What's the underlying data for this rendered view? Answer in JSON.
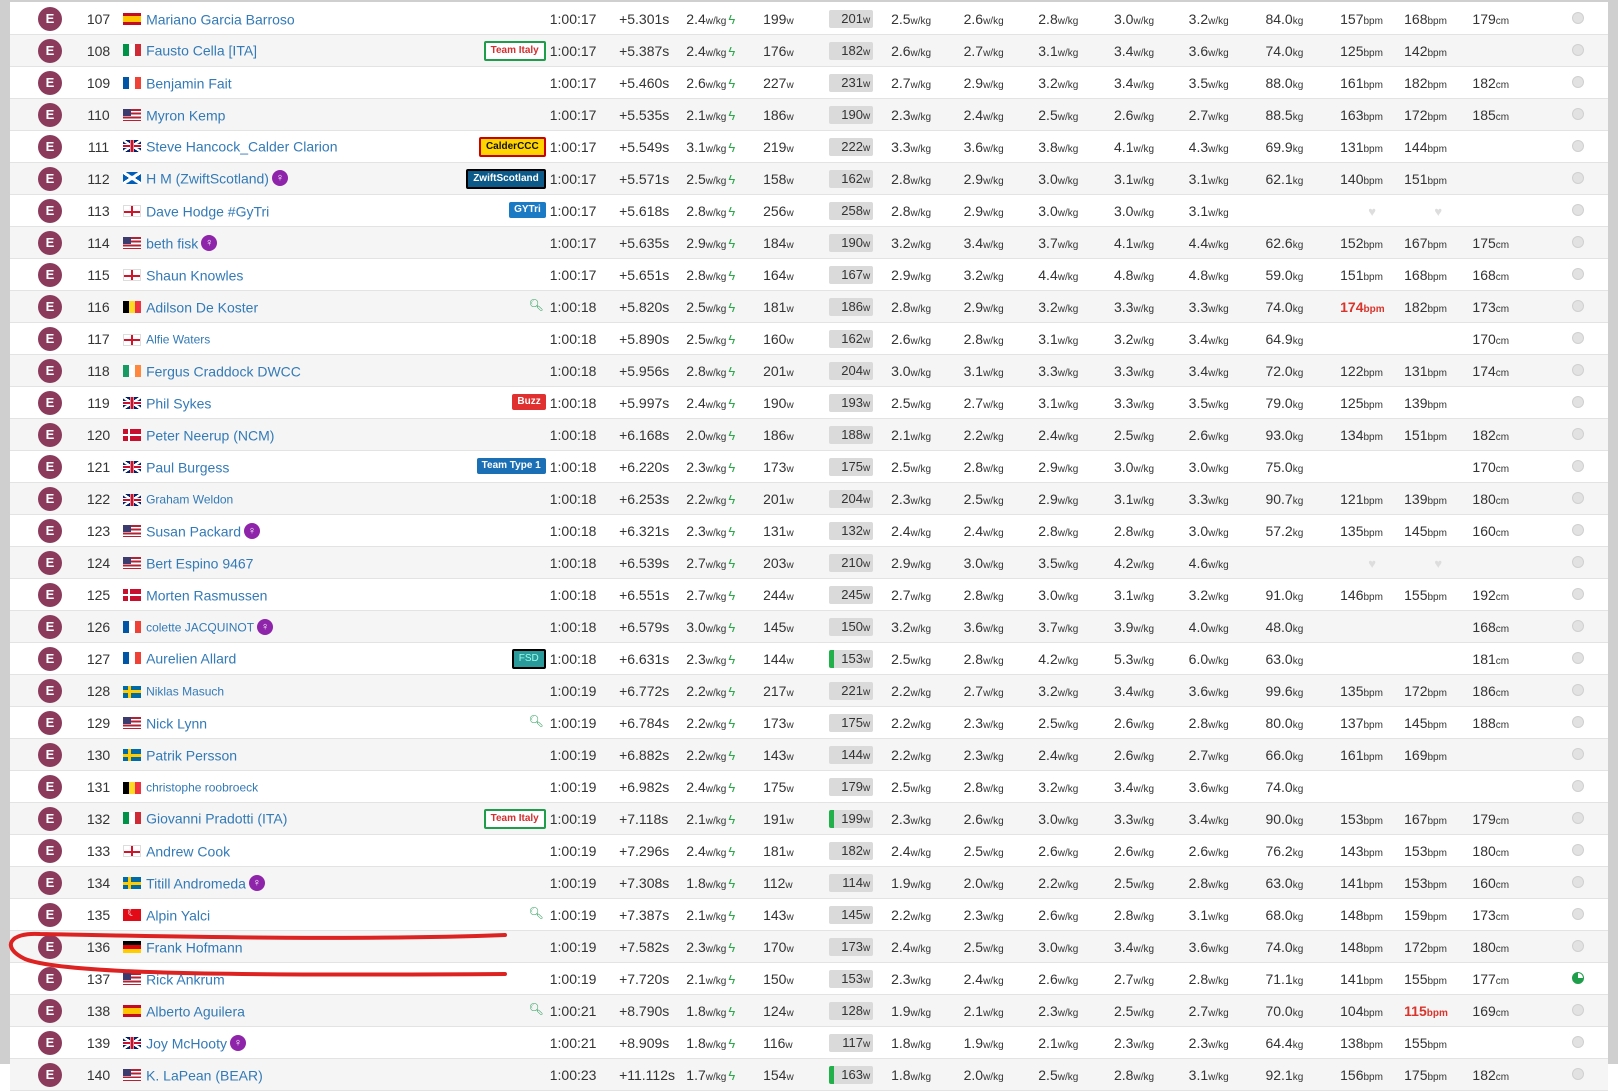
{
  "category_label": "E",
  "colors": {
    "category_badge": "#8b3a5c",
    "link": "#337ab7",
    "bolt": "#2aa84a",
    "annotation": "#dd2222"
  },
  "rows": [
    {
      "pos": "107",
      "flag": "es",
      "name": "Mariano Garcia Barroso",
      "female": false,
      "team": null,
      "search": false,
      "time": "1:00:17",
      "gap": "+5.301s",
      "wkg": "2.4",
      "avg": "199",
      "np": "201",
      "np_green": false,
      "p1": "2.5",
      "p2": "2.6",
      "p3": "2.8",
      "p4": "3.0",
      "p5": "3.2",
      "weight": "84.0",
      "hr1": "157",
      "hr2": "168",
      "height": "179",
      "pie_active": false
    },
    {
      "pos": "108",
      "flag": "it",
      "name": "Fausto Cella [ITA]",
      "female": false,
      "team": {
        "label": "Team Italy",
        "style": "team-italy"
      },
      "search": false,
      "time": "1:00:17",
      "gap": "+5.387s",
      "wkg": "2.4",
      "avg": "176",
      "np": "182",
      "np_green": false,
      "p1": "2.6",
      "p2": "2.7",
      "p3": "3.1",
      "p4": "3.4",
      "p5": "3.6",
      "weight": "74.0",
      "hr1": "125",
      "hr2": "142",
      "height": "",
      "pie_active": false
    },
    {
      "pos": "109",
      "flag": "fr",
      "name": "Benjamin Fait",
      "female": false,
      "team": null,
      "search": false,
      "time": "1:00:17",
      "gap": "+5.460s",
      "wkg": "2.6",
      "avg": "227",
      "np": "231",
      "np_green": false,
      "p1": "2.7",
      "p2": "2.9",
      "p3": "3.2",
      "p4": "3.4",
      "p5": "3.5",
      "weight": "88.0",
      "hr1": "161",
      "hr2": "182",
      "height": "182",
      "pie_active": false
    },
    {
      "pos": "110",
      "flag": "us",
      "name": "Myron Kemp",
      "female": false,
      "team": null,
      "search": false,
      "time": "1:00:17",
      "gap": "+5.535s",
      "wkg": "2.1",
      "avg": "186",
      "np": "190",
      "np_green": false,
      "p1": "2.3",
      "p2": "2.4",
      "p3": "2.5",
      "p4": "2.6",
      "p5": "2.7",
      "weight": "88.5",
      "hr1": "163",
      "hr2": "172",
      "height": "185",
      "pie_active": false
    },
    {
      "pos": "111",
      "flag": "gb",
      "name": "Steve Hancock_Calder Clarion",
      "female": false,
      "team": {
        "label": "CalderCCC",
        "style": "team-calder"
      },
      "search": false,
      "time": "1:00:17",
      "gap": "+5.549s",
      "wkg": "3.1",
      "avg": "219",
      "np": "222",
      "np_green": false,
      "p1": "3.3",
      "p2": "3.6",
      "p3": "3.8",
      "p4": "4.1",
      "p5": "4.3",
      "weight": "69.9",
      "hr1": "131",
      "hr2": "144",
      "height": "",
      "pie_active": false
    },
    {
      "pos": "112",
      "flag": "sc",
      "name": "H M (ZwiftScotland)",
      "female": true,
      "team": {
        "label": "ZwiftScotland",
        "style": "team-zs"
      },
      "search": false,
      "time": "1:00:17",
      "gap": "+5.571s",
      "wkg": "2.5",
      "avg": "158",
      "np": "162",
      "np_green": false,
      "p1": "2.8",
      "p2": "2.9",
      "p3": "3.0",
      "p4": "3.1",
      "p5": "3.1",
      "weight": "62.1",
      "hr1": "140",
      "hr2": "151",
      "height": "",
      "pie_active": false
    },
    {
      "pos": "113",
      "flag": "en",
      "name": "Dave Hodge #GyTri",
      "female": false,
      "team": {
        "label": "GYTri",
        "style": "team-gytri"
      },
      "search": false,
      "time": "1:00:17",
      "gap": "+5.618s",
      "wkg": "2.8",
      "avg": "256",
      "np": "258",
      "np_green": false,
      "p1": "2.8",
      "p2": "2.9",
      "p3": "3.0",
      "p4": "3.0",
      "p5": "3.1",
      "weight": "",
      "hr1": "",
      "hr2": "",
      "height": "",
      "no_hr": true,
      "pie_active": false
    },
    {
      "pos": "114",
      "flag": "us",
      "name": "beth fisk",
      "female": true,
      "team": null,
      "search": false,
      "time": "1:00:17",
      "gap": "+5.635s",
      "wkg": "2.9",
      "avg": "184",
      "np": "190",
      "np_green": false,
      "p1": "3.2",
      "p2": "3.4",
      "p3": "3.7",
      "p4": "4.1",
      "p5": "4.4",
      "weight": "62.6",
      "hr1": "152",
      "hr2": "167",
      "height": "175",
      "pie_active": false
    },
    {
      "pos": "115",
      "flag": "en",
      "name": "Shaun Knowles",
      "female": false,
      "team": null,
      "search": false,
      "time": "1:00:17",
      "gap": "+5.651s",
      "wkg": "2.8",
      "avg": "164",
      "np": "167",
      "np_green": false,
      "p1": "2.9",
      "p2": "3.2",
      "p3": "4.4",
      "p4": "4.8",
      "p5": "4.8",
      "weight": "59.0",
      "hr1": "151",
      "hr2": "168",
      "height": "168",
      "pie_active": false
    },
    {
      "pos": "116",
      "flag": "be",
      "name": "Adilson De Koster",
      "female": false,
      "team": null,
      "search": true,
      "time": "1:00:18",
      "gap": "+5.820s",
      "wkg": "2.5",
      "avg": "181",
      "np": "186",
      "np_green": false,
      "p1": "2.8",
      "p2": "2.9",
      "p3": "3.2",
      "p4": "3.3",
      "p5": "3.3",
      "weight": "74.0",
      "hr1": "174",
      "hr1_red": true,
      "hr2": "182",
      "height": "173",
      "pie_active": false
    },
    {
      "pos": "117",
      "flag": "en",
      "name": "Alfie Waters",
      "small": true,
      "female": false,
      "team": null,
      "search": false,
      "time": "1:00:18",
      "gap": "+5.890s",
      "wkg": "2.5",
      "avg": "160",
      "np": "162",
      "np_green": false,
      "p1": "2.6",
      "p2": "2.8",
      "p3": "3.1",
      "p4": "3.2",
      "p5": "3.4",
      "weight": "64.9",
      "hr1": "",
      "hr2": "",
      "height": "170",
      "pie_active": false
    },
    {
      "pos": "118",
      "flag": "ie",
      "name": "Fergus Craddock DWCC",
      "female": false,
      "team": null,
      "search": false,
      "time": "1:00:18",
      "gap": "+5.956s",
      "wkg": "2.8",
      "avg": "201",
      "np": "204",
      "np_green": false,
      "p1": "3.0",
      "p2": "3.1",
      "p3": "3.3",
      "p4": "3.3",
      "p5": "3.4",
      "weight": "72.0",
      "hr1": "122",
      "hr2": "131",
      "height": "174",
      "pie_active": false
    },
    {
      "pos": "119",
      "flag": "gb",
      "name": "Phil Sykes",
      "female": false,
      "team": {
        "label": "Buzz",
        "style": "team-buzz"
      },
      "search": false,
      "time": "1:00:18",
      "gap": "+5.997s",
      "wkg": "2.4",
      "avg": "190",
      "np": "193",
      "np_green": false,
      "p1": "2.5",
      "p2": "2.7",
      "p3": "3.1",
      "p4": "3.3",
      "p5": "3.5",
      "weight": "79.0",
      "hr1": "125",
      "hr2": "139",
      "height": "",
      "pie_active": false
    },
    {
      "pos": "120",
      "flag": "dk",
      "name": "Peter Neerup (NCM)",
      "female": false,
      "team": null,
      "search": false,
      "time": "1:00:18",
      "gap": "+6.168s",
      "wkg": "2.0",
      "avg": "186",
      "np": "188",
      "np_green": false,
      "p1": "2.1",
      "p2": "2.2",
      "p3": "2.4",
      "p4": "2.5",
      "p5": "2.6",
      "weight": "93.0",
      "hr1": "134",
      "hr2": "151",
      "height": "182",
      "pie_active": false
    },
    {
      "pos": "121",
      "flag": "gb",
      "name": "Paul Burgess",
      "female": false,
      "team": {
        "label": "Team Type 1",
        "style": "team-t1"
      },
      "search": false,
      "time": "1:00:18",
      "gap": "+6.220s",
      "wkg": "2.3",
      "avg": "173",
      "np": "175",
      "np_green": false,
      "p1": "2.5",
      "p2": "2.8",
      "p3": "2.9",
      "p4": "3.0",
      "p5": "3.0",
      "weight": "75.0",
      "hr1": "",
      "hr2": "",
      "height": "170",
      "pie_active": false
    },
    {
      "pos": "122",
      "flag": "gb",
      "name": "Graham Weldon",
      "small": true,
      "female": false,
      "team": null,
      "search": false,
      "time": "1:00:18",
      "gap": "+6.253s",
      "wkg": "2.2",
      "avg": "201",
      "np": "204",
      "np_green": false,
      "p1": "2.3",
      "p2": "2.5",
      "p3": "2.9",
      "p4": "3.1",
      "p5": "3.3",
      "weight": "90.7",
      "hr1": "121",
      "hr2": "139",
      "height": "180",
      "pie_active": false
    },
    {
      "pos": "123",
      "flag": "us",
      "name": "Susan Packard",
      "female": true,
      "team": null,
      "search": false,
      "time": "1:00:18",
      "gap": "+6.321s",
      "wkg": "2.3",
      "avg": "131",
      "np": "132",
      "np_green": false,
      "p1": "2.4",
      "p2": "2.4",
      "p3": "2.8",
      "p4": "2.8",
      "p5": "3.0",
      "weight": "57.2",
      "hr1": "135",
      "hr2": "145",
      "height": "160",
      "pie_active": false
    },
    {
      "pos": "124",
      "flag": "us",
      "name": "Bert Espino 9467",
      "female": false,
      "team": null,
      "search": false,
      "time": "1:00:18",
      "gap": "+6.539s",
      "wkg": "2.7",
      "avg": "203",
      "np": "210",
      "np_green": false,
      "p1": "2.9",
      "p2": "3.0",
      "p3": "3.5",
      "p4": "4.2",
      "p5": "4.6",
      "weight": "",
      "hr1": "",
      "hr2": "",
      "height": "",
      "no_hr": true,
      "pie_active": false
    },
    {
      "pos": "125",
      "flag": "dk",
      "name": "Morten Rasmussen",
      "female": false,
      "team": null,
      "search": false,
      "time": "1:00:18",
      "gap": "+6.551s",
      "wkg": "2.7",
      "avg": "244",
      "np": "245",
      "np_green": false,
      "p1": "2.7",
      "p2": "2.8",
      "p3": "3.0",
      "p4": "3.1",
      "p5": "3.2",
      "weight": "91.0",
      "hr1": "146",
      "hr2": "155",
      "height": "192",
      "pie_active": false
    },
    {
      "pos": "126",
      "flag": "fr",
      "name": "colette JACQUINOT",
      "small": true,
      "female": true,
      "team": null,
      "search": false,
      "time": "1:00:18",
      "gap": "+6.579s",
      "wkg": "3.0",
      "avg": "145",
      "np": "150",
      "np_green": false,
      "p1": "3.2",
      "p2": "3.6",
      "p3": "3.7",
      "p4": "3.9",
      "p5": "4.0",
      "weight": "48.0",
      "hr1": "",
      "hr2": "",
      "height": "168",
      "pie_active": false
    },
    {
      "pos": "127",
      "flag": "fr",
      "name": "Aurelien Allard",
      "female": false,
      "team": {
        "label": "FSD",
        "style": "team-fsd"
      },
      "search": false,
      "time": "1:00:18",
      "gap": "+6.631s",
      "wkg": "2.3",
      "avg": "144",
      "np": "153",
      "np_green": true,
      "p1": "2.5",
      "p2": "2.8",
      "p3": "4.2",
      "p4": "5.3",
      "p5": "6.0",
      "weight": "63.0",
      "hr1": "",
      "hr2": "",
      "height": "181",
      "pie_active": false
    },
    {
      "pos": "128",
      "flag": "se",
      "name": "Niklas Masuch",
      "small": true,
      "female": false,
      "team": null,
      "search": false,
      "time": "1:00:19",
      "gap": "+6.772s",
      "wkg": "2.2",
      "avg": "217",
      "np": "221",
      "np_green": false,
      "p1": "2.2",
      "p2": "2.7",
      "p3": "3.2",
      "p4": "3.4",
      "p5": "3.6",
      "weight": "99.6",
      "hr1": "135",
      "hr2": "172",
      "height": "186",
      "pie_active": false
    },
    {
      "pos": "129",
      "flag": "us",
      "name": "Nick Lynn",
      "female": false,
      "team": null,
      "search": true,
      "time": "1:00:19",
      "gap": "+6.784s",
      "wkg": "2.2",
      "avg": "173",
      "np": "175",
      "np_green": false,
      "p1": "2.2",
      "p2": "2.3",
      "p3": "2.5",
      "p4": "2.6",
      "p5": "2.8",
      "weight": "80.0",
      "hr1": "137",
      "hr2": "145",
      "height": "188",
      "pie_active": false
    },
    {
      "pos": "130",
      "flag": "se",
      "name": "Patrik Persson",
      "female": false,
      "team": null,
      "search": false,
      "time": "1:00:19",
      "gap": "+6.882s",
      "wkg": "2.2",
      "avg": "143",
      "np": "144",
      "np_green": false,
      "p1": "2.2",
      "p2": "2.3",
      "p3": "2.4",
      "p4": "2.6",
      "p5": "2.7",
      "weight": "66.0",
      "hr1": "161",
      "hr2": "169",
      "height": "",
      "pie_active": false
    },
    {
      "pos": "131",
      "flag": "be",
      "name": "christophe roobroeck",
      "small": true,
      "female": false,
      "team": null,
      "search": false,
      "time": "1:00:19",
      "gap": "+6.982s",
      "wkg": "2.4",
      "avg": "175",
      "np": "179",
      "np_green": false,
      "p1": "2.5",
      "p2": "2.8",
      "p3": "3.2",
      "p4": "3.4",
      "p5": "3.6",
      "weight": "74.0",
      "hr1": "",
      "hr2": "",
      "height": "",
      "pie_active": false
    },
    {
      "pos": "132",
      "flag": "it",
      "name": "Giovanni Pradotti (ITA)",
      "female": false,
      "team": {
        "label": "Team Italy",
        "style": "team-italy"
      },
      "search": false,
      "time": "1:00:19",
      "gap": "+7.118s",
      "wkg": "2.1",
      "avg": "191",
      "np": "199",
      "np_green": true,
      "p1": "2.3",
      "p2": "2.6",
      "p3": "3.0",
      "p4": "3.3",
      "p5": "3.4",
      "weight": "90.0",
      "hr1": "153",
      "hr2": "167",
      "height": "179",
      "pie_active": false
    },
    {
      "pos": "133",
      "flag": "en",
      "name": "Andrew Cook",
      "female": false,
      "team": null,
      "search": false,
      "time": "1:00:19",
      "gap": "+7.296s",
      "wkg": "2.4",
      "avg": "181",
      "np": "182",
      "np_green": false,
      "p1": "2.4",
      "p2": "2.5",
      "p3": "2.6",
      "p4": "2.6",
      "p5": "2.6",
      "weight": "76.2",
      "hr1": "143",
      "hr2": "153",
      "height": "180",
      "pie_active": false
    },
    {
      "pos": "134",
      "flag": "se",
      "name": "Titill Andromeda",
      "female": true,
      "team": null,
      "search": false,
      "time": "1:00:19",
      "gap": "+7.308s",
      "wkg": "1.8",
      "avg": "112",
      "np": "114",
      "np_green": false,
      "p1": "1.9",
      "p2": "2.0",
      "p3": "2.2",
      "p4": "2.5",
      "p5": "2.8",
      "weight": "63.0",
      "hr1": "141",
      "hr2": "153",
      "height": "160",
      "pie_active": false
    },
    {
      "pos": "135",
      "flag": "tr",
      "name": "Alpin Yalci",
      "female": false,
      "team": null,
      "search": true,
      "time": "1:00:19",
      "gap": "+7.387s",
      "wkg": "2.1",
      "avg": "143",
      "np": "145",
      "np_green": false,
      "p1": "2.2",
      "p2": "2.3",
      "p3": "2.6",
      "p4": "2.8",
      "p5": "3.1",
      "weight": "68.0",
      "hr1": "148",
      "hr2": "159",
      "height": "173",
      "pie_active": false
    },
    {
      "pos": "136",
      "flag": "de",
      "name": "Frank Hofmann",
      "female": false,
      "team": null,
      "search": false,
      "time": "1:00:19",
      "gap": "+7.582s",
      "wkg": "2.3",
      "avg": "170",
      "np": "173",
      "np_green": false,
      "p1": "2.4",
      "p2": "2.5",
      "p3": "3.0",
      "p4": "3.4",
      "p5": "3.6",
      "weight": "74.0",
      "hr1": "148",
      "hr2": "172",
      "height": "180",
      "pie_active": false
    },
    {
      "pos": "137",
      "flag": "us",
      "name": "Rick Ankrum",
      "female": false,
      "team": null,
      "search": false,
      "time": "1:00:19",
      "gap": "+7.720s",
      "wkg": "2.1",
      "avg": "150",
      "np": "153",
      "np_green": false,
      "p1": "2.3",
      "p2": "2.4",
      "p3": "2.6",
      "p4": "2.7",
      "p5": "2.8",
      "weight": "71.1",
      "hr1": "141",
      "hr2": "155",
      "height": "177",
      "pie_active": true
    },
    {
      "pos": "138",
      "flag": "es",
      "name": "Alberto Aguilera",
      "female": false,
      "team": null,
      "search": true,
      "time": "1:00:21",
      "gap": "+8.790s",
      "wkg": "1.8",
      "avg": "124",
      "np": "128",
      "np_green": false,
      "p1": "1.9",
      "p2": "2.1",
      "p3": "2.3",
      "p4": "2.5",
      "p5": "2.7",
      "weight": "70.0",
      "hr1": "104",
      "hr2": "115",
      "hr2_red": true,
      "height": "169",
      "pie_active": false
    },
    {
      "pos": "139",
      "flag": "gb",
      "name": "Joy McHooty",
      "female": true,
      "team": null,
      "search": false,
      "time": "1:00:21",
      "gap": "+8.909s",
      "wkg": "1.8",
      "avg": "116",
      "np": "117",
      "np_green": false,
      "p1": "1.8",
      "p2": "1.9",
      "p3": "2.1",
      "p4": "2.3",
      "p5": "2.3",
      "weight": "64.4",
      "hr1": "138",
      "hr2": "155",
      "height": "",
      "pie_active": false
    },
    {
      "pos": "140",
      "flag": "us",
      "name": "K. LaPean (BEAR)",
      "female": false,
      "team": null,
      "search": false,
      "time": "1:00:23",
      "gap": "+11.112s",
      "wkg": "1.7",
      "avg": "154",
      "np": "163",
      "np_green": true,
      "p1": "1.8",
      "p2": "2.0",
      "p3": "2.5",
      "p4": "2.8",
      "p5": "3.1",
      "weight": "92.1",
      "hr1": "156",
      "hr2": "175",
      "height": "182",
      "pie_active": false
    }
  ]
}
